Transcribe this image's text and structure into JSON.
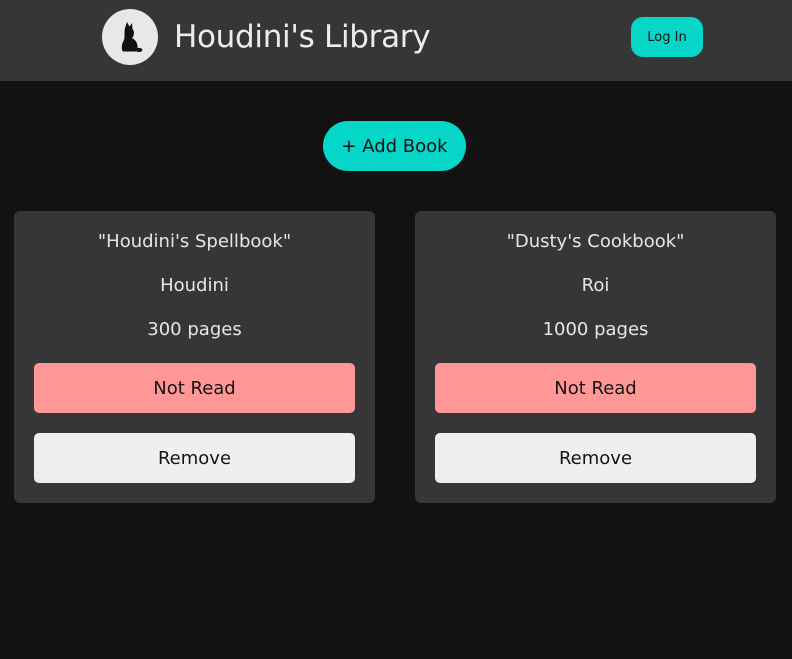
{
  "header": {
    "logo_icon": "cat-icon",
    "title": "Houdini's Library",
    "login_label": "Log In"
  },
  "toolbar": {
    "add_book_label": "+ Add Book"
  },
  "colors": {
    "accent": "#06d6c8",
    "not_read": "#ff9796",
    "card_bg": "#363636",
    "page_bg": "#121212"
  },
  "books": [
    {
      "title": "\"Houdini's Spellbook\"",
      "author": "Houdini",
      "pages": "300 pages",
      "status_label": "Not Read",
      "remove_label": "Remove"
    },
    {
      "title": "\"Dusty's Cookbook\"",
      "author": "Roi",
      "pages": "1000 pages",
      "status_label": "Not Read",
      "remove_label": "Remove"
    }
  ]
}
